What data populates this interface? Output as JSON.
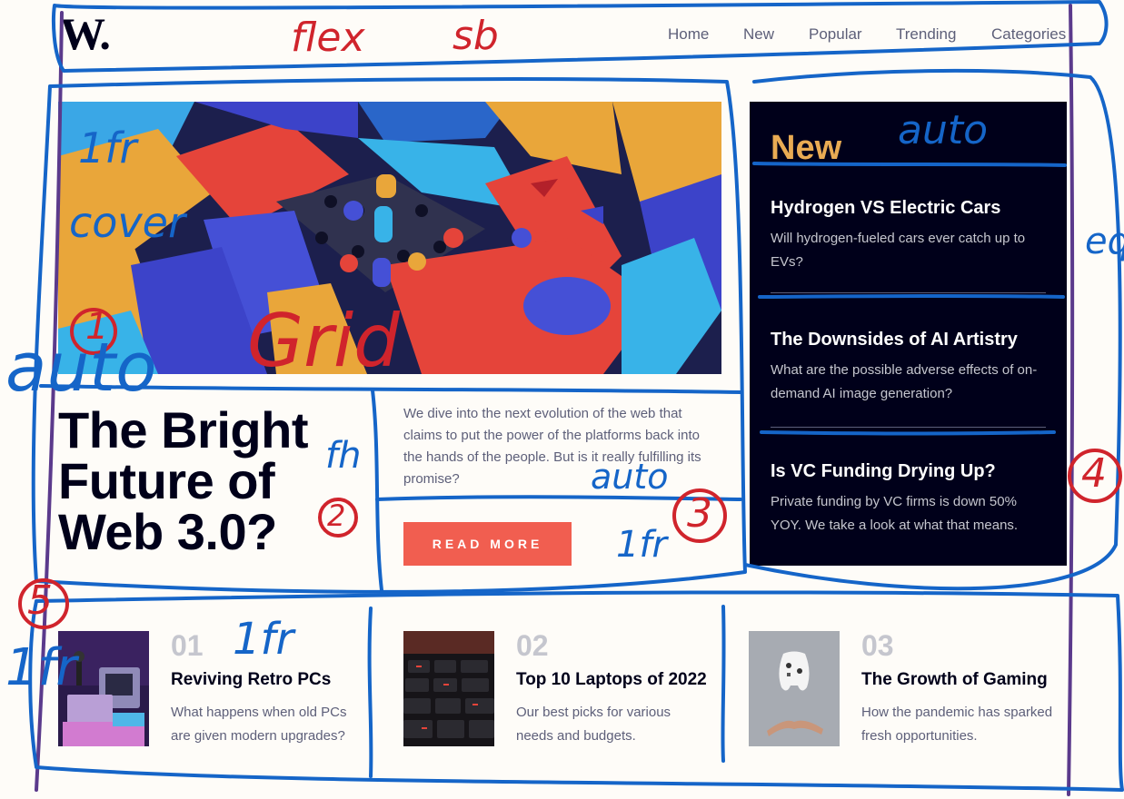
{
  "header": {
    "logo": "W.",
    "nav": [
      "Home",
      "New",
      "Popular",
      "Trending",
      "Categories"
    ]
  },
  "hero": {
    "title": "The Bright Future of Web 3.0?",
    "description": "We dive into the next evolution of the web that claims to put the power of the platforms back into the hands of the people. But is it really fulfilling its promise?",
    "button": "READ MORE"
  },
  "new_panel": {
    "heading": "New",
    "items": [
      {
        "title": "Hydrogen VS Electric Cars",
        "desc": "Will hydrogen-fueled cars ever catch up to EVs?"
      },
      {
        "title": "The Downsides of AI Artistry",
        "desc": "What are the possible adverse effects of on-demand AI image generation?"
      },
      {
        "title": "Is VC Funding Drying Up?",
        "desc": "Private funding by VC firms is down 50% YOY. We take a look at what that means."
      }
    ]
  },
  "bottom": [
    {
      "num": "01",
      "title": "Reviving Retro PCs",
      "desc": "What happens when old PCs are given modern upgrades?"
    },
    {
      "num": "02",
      "title": "Top 10 Laptops of 2022",
      "desc": "Our best picks for various needs and budgets."
    },
    {
      "num": "03",
      "title": "The Growth of Gaming",
      "desc": "How the pandemic has sparked fresh opportunities."
    }
  ],
  "annotations": {
    "flex": "flex",
    "sb": "sb",
    "auto_top": "auto",
    "lfr_img": "1fr",
    "cover": "cover",
    "one": "1",
    "grid": "Grid",
    "auto_left": "auto",
    "fh": "fh",
    "two": "2",
    "auto_mid": "auto",
    "three": "3",
    "lfr_mid": "1fr",
    "four": "4",
    "five": "5",
    "lfr_bottom": "1fr",
    "lfr_left": "1fr",
    "eq": "eq"
  },
  "colors": {
    "background": "#fefcf8",
    "dark": "#00001a",
    "accent_red": "#f15e50",
    "accent_orange": "#e9ab53",
    "gray": "#5d5f79",
    "light_gray": "#c5c6ce",
    "annotation_red": "#d0242c",
    "annotation_blue": "#1565c8",
    "annotation_purple": "#5b3a8c"
  }
}
